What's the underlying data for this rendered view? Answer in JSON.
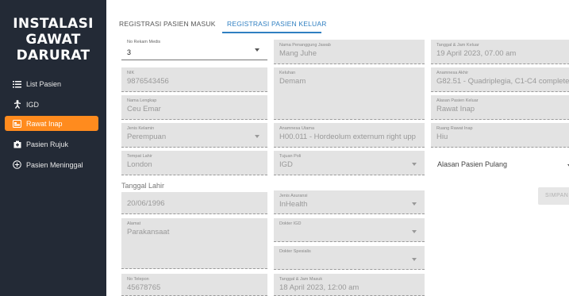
{
  "sidebar": {
    "title_line1": "INSTALASI",
    "title_line2": "GAWAT",
    "title_line3": "DARURAT",
    "items": [
      {
        "label": "List Pasien",
        "icon": "list-icon"
      },
      {
        "label": "IGD",
        "icon": "person-walking-icon"
      },
      {
        "label": "Rawat Inap",
        "icon": "bed-icon",
        "active": true
      },
      {
        "label": "Pasien Rujuk",
        "icon": "hospital-icon"
      },
      {
        "label": "Pasien Meninggal",
        "icon": "plus-circle-icon"
      }
    ]
  },
  "tabs": [
    {
      "label": "REGISTRASI PASIEN MASUK"
    },
    {
      "label": "REGISTRASI PASIEN KELUAR",
      "active": true
    }
  ],
  "form": {
    "no_rekam_medis": {
      "label": "No Rekam Medis",
      "value": "3"
    },
    "nik": {
      "label": "NIK",
      "value": "9876543456"
    },
    "nama_lengkap": {
      "label": "Nama Lengkap",
      "value": "Ceu Emar"
    },
    "jenis_kelamin": {
      "label": "Jenis Kelamin",
      "value": "Perempuan"
    },
    "tempat_lahir": {
      "label": "Tempat Lahir",
      "value": "London"
    },
    "tanggal_lahir": {
      "label": "Tanggal Lahir",
      "value": "20/06/1996"
    },
    "alamat": {
      "label": "Alamat",
      "value": "Parakansaat"
    },
    "no_telepon": {
      "label": "No Telepon",
      "value": "45678765"
    },
    "nama_penanggung_jawab": {
      "label": "Nama Penanggung Jawab",
      "value": "Mang Juhe"
    },
    "keluhan": {
      "label": "Keluhan",
      "value": "Demam"
    },
    "anamnesa_utama": {
      "label": "Anamnesa Utama",
      "value": "H00.011 - Hordeolum externum right upp"
    },
    "tujuan_poli": {
      "label": "Tujuan Poli",
      "value": "IGD"
    },
    "jenis_asuransi": {
      "label": "Jenis Asuransi",
      "value": "InHealth"
    },
    "dokter_igd": {
      "label": "Dokter IGD",
      "value": ""
    },
    "dokter_spesialis": {
      "label": "Dokter Spesialis",
      "value": ""
    },
    "tanggal_jam_masuk": {
      "label": "Tanggal & Jam Masuk",
      "value": "18 April 2023, 12:00 am"
    },
    "tanggal_jam_keluar": {
      "label": "Tanggal & Jam Keluar",
      "value": "19 April 2023, 07.00 am"
    },
    "anamnesa_akhir": {
      "label": "Anamnesa Akhir",
      "value": "G82.51 - Quadriplegia, C1-C4 complete"
    },
    "alasan_pasien_keluar": {
      "label": "Alasan Pasien Keluar",
      "value": "Rawat Inap"
    },
    "ruang_rawat_inap": {
      "label": "Ruang Rawat Inap",
      "value": "Hiu"
    },
    "alasan_pasien_pulang": {
      "label": "Alasan Pasien Pulang"
    },
    "simpan_label": "SIMPAN"
  }
}
